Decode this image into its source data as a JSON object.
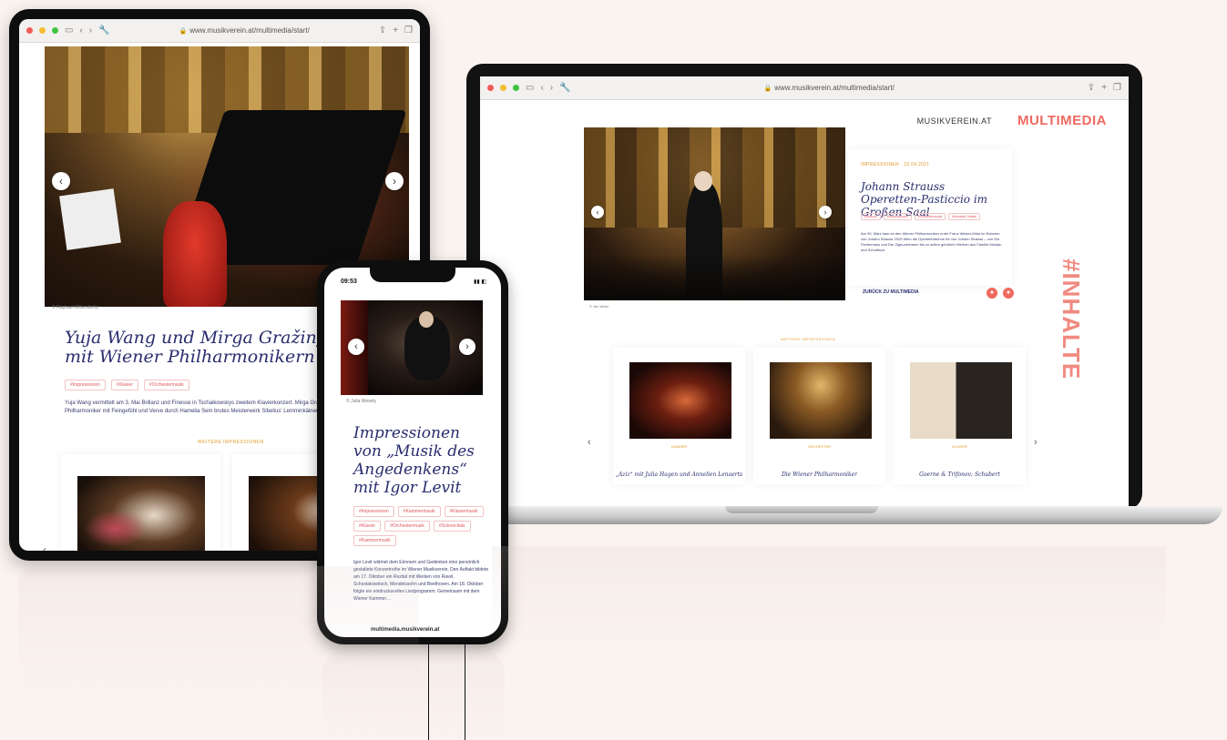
{
  "tablet": {
    "url": "www.musikverein.at/multimedia/start/",
    "photo_credit": "© Raphael Mittendorfer",
    "title": "Yuja Wang und Mirga Gražinytė-Tyla mit Wiener Philharmonikern",
    "tags": [
      "#Impressionen",
      "#Klavier",
      "#Orchestermusik"
    ],
    "body": "Yuja Wang vermittelt am 3. Mai Brillanz und Finesse in Tschaikowskys zweitem Klavierkonzert. Mirga Gražinytė-Tyla die Wiener Philharmoniker mit Feingefühl und Verve durch Hamelia Sem brutes Meisterwerk Sibelius' Lemminkäinen-Suite, op. 22 führte.",
    "section_label": "Weitere Impressionen"
  },
  "laptop": {
    "url": "www.musikverein.at/multimedia/start/",
    "brand": "MUSIKVEREIN.AT",
    "section_title": "MULTIMEDIA",
    "hero_credit": "© Jan Wüst",
    "meta": "IMPRESSIONEN · 22.04.2021",
    "title": "Johann Strauss Operetten-Pasticcio im Großen Saal",
    "tags": [
      "#Strauss",
      "#Impressionen",
      "#Orchestermusik",
      "#Neueste Details"
    ],
    "body": "Am 30. März kam es den Wiener Philharmoniker unter Franz Welser-Möst im Rahmen von Johann Strauss 2025 Wien die Operettenbühne für von Johann Strauss – von Die Fledermaus und Der Zigeunerbaron bis zu selten gehörten Werken aus Familie Moldau and Schottisch.",
    "back_label": "ZURÜCK ZU MULTIMEDIA",
    "inhalte": "#INHALTE",
    "section_label": "Weitere Impressionen",
    "cards": [
      {
        "category": "KAMMER",
        "title": "„Aziz“ mit Julia Hagen und Annelien Lenaerts"
      },
      {
        "category": "ORCHESTER",
        "title": "Die Wiener Philharmoniker"
      },
      {
        "category": "KLAVIER",
        "title": "Goerne & Trifonov: Schubert"
      }
    ]
  },
  "phone": {
    "time": "09:53",
    "photo_credit": "© Julia Wesely",
    "title": "Impressionen von „Musik des Angedenkens“ mit Igor Levit",
    "tags": [
      "#Impressionen",
      "#Kammermusik",
      "#Klaviermusik",
      "#Klavier",
      "#Orchestermusik",
      "#Solorecitals",
      "#Kammermusik"
    ],
    "body": "Igor Levit widmet dem Erinnern und Gedenken eine persönlich gestaltete Konzertreihe im Wiener Musikverein. Den Auftakt bildete am 17. Oktober ein Rezital mit Werken von Ravel, Schostakowitsch, Mendelssohn und Beethoven. Am 18. Oktober folgte ein eindrucksvolles Liedprogramm. Gemeinsam mit dem Wiener Kammer…",
    "url_pill": "multimedia.musikverein.at"
  }
}
